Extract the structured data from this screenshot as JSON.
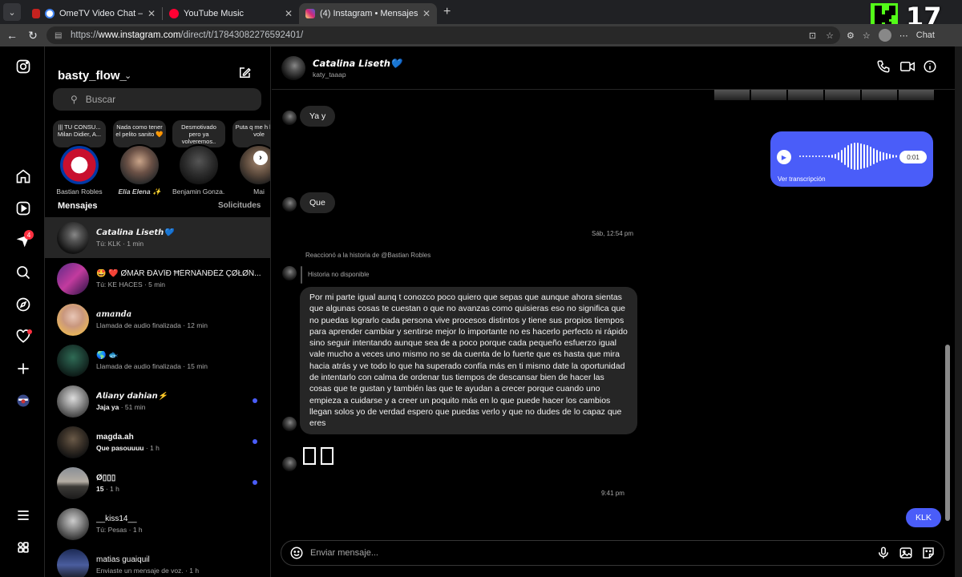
{
  "browser": {
    "tabs": [
      {
        "title": "OmeTV Video Chat — Omegle",
        "color": "#d93025"
      },
      {
        "title": "YouTube Music",
        "color": "#ff0033"
      },
      {
        "title": "(4) Instagram • Mensajes",
        "color": "#d6249f"
      }
    ],
    "url_scheme": "https://",
    "url_host": "www.instagram.com",
    "url_path": "/direct/t/17843082276592401/",
    "chat_label": "Chat",
    "overlay_number": "17"
  },
  "rail": {
    "badge_count": "4"
  },
  "inbox": {
    "account": "basty_flow_",
    "search_placeholder": "Buscar",
    "notes": [
      {
        "text": "||| TU CONSU... Milan Didier, A...",
        "name": "Bastian Robles"
      },
      {
        "text": "Nada como tener el pelito sanito 🧡",
        "name": "Elia Elena ✨"
      },
      {
        "text": "Desmotivado pero ya volveremos..",
        "name": "Benjamin Gonza..."
      },
      {
        "text": "Puta q me h bn el vole",
        "name": "Mai"
      }
    ],
    "section_title": "Mensajes",
    "requests_label": "Solicitudes",
    "conversations": [
      {
        "name": "𝘾𝙖𝙩𝙖𝙡𝙞𝙣𝙖 𝙇𝙞𝙨𝙚𝙩𝙝💙",
        "sub": "Tú: KLK · 1 min"
      },
      {
        "name": "🤩 ❤️ ØMÄR ĐÄVÏĐ ĦËŘÑÄÑĐĚŽ ÇØŁØÑ...",
        "sub": "Tú: KE HACES · 5 min"
      },
      {
        "name": "𝒂𝒎𝒂𝒏𝒅𝒂",
        "sub": "Llamada de audio finalizada · 12 min"
      },
      {
        "name": "🌎 🐟",
        "sub": "Llamada de audio finalizada · 15 min"
      },
      {
        "name": "𝘼𝙡𝙞𝙖𝙣𝙮 𝙙𝙖𝙝𝙞𝙖𝙣⚡",
        "sub": "Jaja ya",
        "time": " · 51 min"
      },
      {
        "name": "magda.ah",
        "sub": "Que pasouuuu",
        "time": " · 1 h"
      },
      {
        "name": "Ø▯▯▯",
        "sub": "15",
        "time": " · 1 h"
      },
      {
        "name": "__kiss14__",
        "sub": "Tú: Pesas · 1 h"
      },
      {
        "name": "matias guaiquil",
        "sub": "Enviaste un mensaje de voz. · 1 h"
      }
    ]
  },
  "chat": {
    "name": "𝘾𝙖𝙩𝙖𝙡𝙞𝙣𝙖 𝙇𝙞𝙨𝙚𝙩𝙝💙",
    "username": "katy_taaap",
    "msg_ya": "Ya y",
    "voice_duration": "0:01",
    "voice_transcript": "Ver transcripción",
    "msg_que": "Que",
    "timestamp_1": "Sáb, 12:54 pm",
    "story_reaction": "Reaccionó a la historia de @Bastian Robles",
    "story_unavailable": "Historia no disponible",
    "long_message": "Por mi parte igual aunq t conozco poco quiero que sepas que aunque ahora sientas que algunas cosas te cuestan o que no avanzas como quisieras eso no significa que no puedas lograrlo cada persona vive procesos distintos y tiene sus propios tiempos para aprender cambiar y sentirse mejor lo importante no es hacerlo perfecto ni rápido sino seguir intentando aunque sea de a poco porque cada pequeño esfuerzo igual vale mucho a veces uno mismo no se da cuenta de lo fuerte que es hasta que mira hacia atrás y ve todo lo que ha superado confía más en ti mismo date la oportunidad de intentarlo con calma de ordenar tus tiempos de descansar bien de hacer las cosas que te gustan y también las que te ayudan a crecer porque cuando uno empieza a cuidarse y a creer un poquito más en lo que puede hacer los cambios llegan solos yo de verdad espero que puedas verlo y que no dudes de lo capaz que eres",
    "timestamp_2": "9:41 pm",
    "msg_klk": "KLK",
    "composer_placeholder": "Enviar mensaje..."
  },
  "colors": {
    "outgoing_bubble": "#4a5df9",
    "incoming_bubble": "#262626",
    "unread_dot": "#4a5df9",
    "badge": "#ff3040"
  }
}
